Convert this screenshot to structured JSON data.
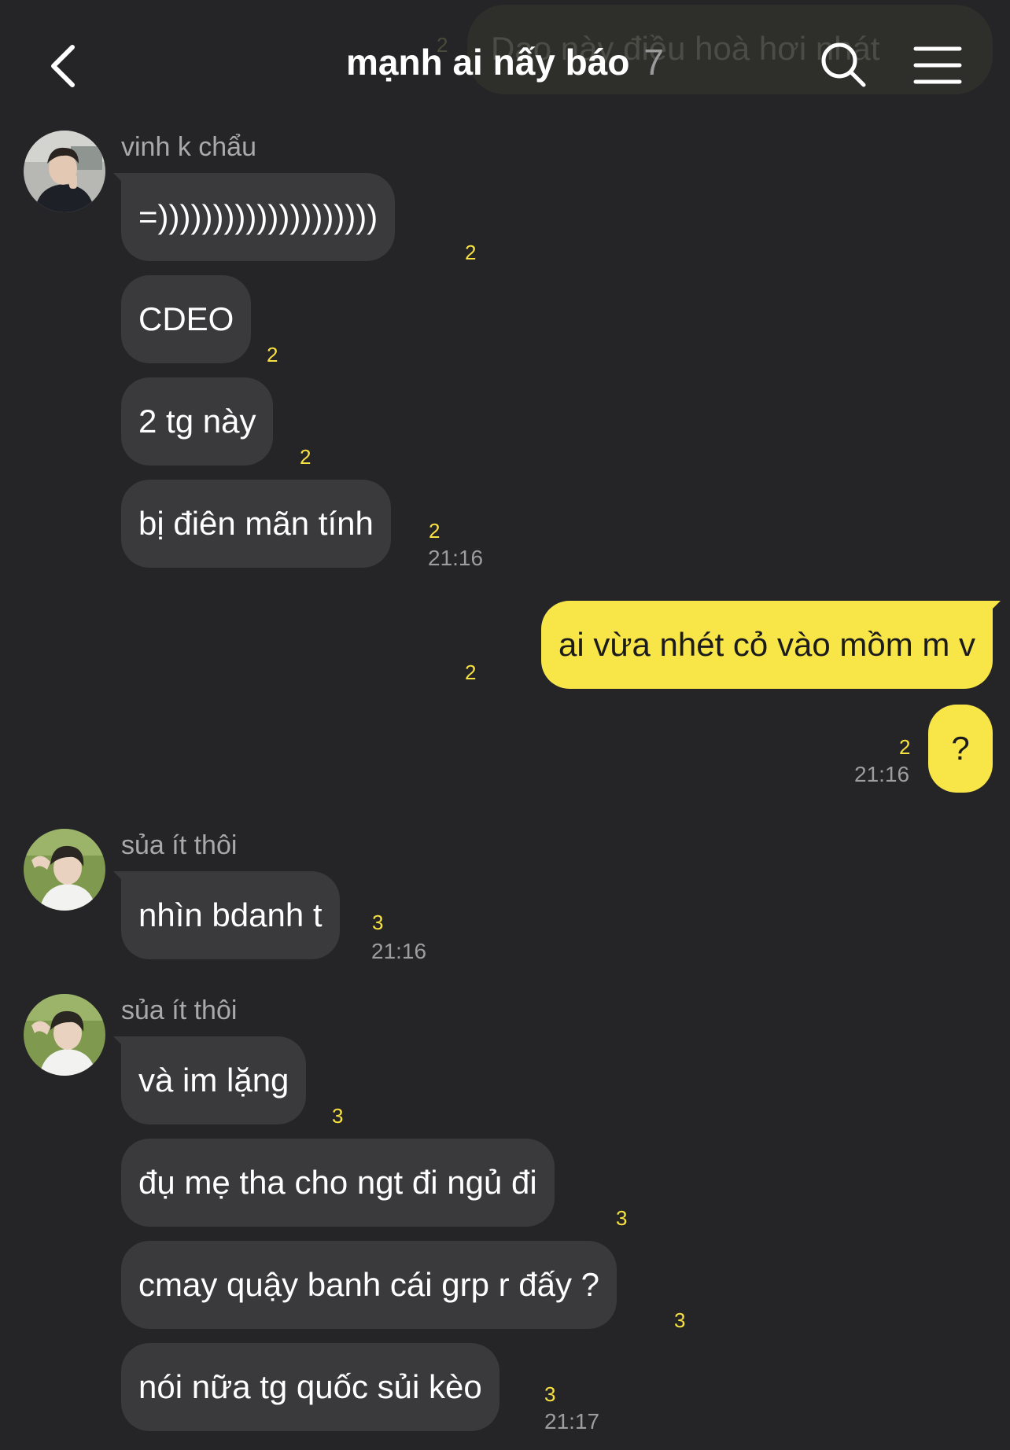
{
  "header": {
    "title": "mạnh ai nấy báo",
    "member_count": "7",
    "back_icon": "chevron-left-icon",
    "search_icon": "search-icon",
    "menu_icon": "hamburger-menu-icon",
    "pinned_preview": {
      "text": "Dạo này điều hoà hơi nhát",
      "count": "2"
    }
  },
  "messages": {
    "g1": {
      "sender": "vinh k chẩu",
      "m1": {
        "text": "=))))))))))))))))))))",
        "unread": "2"
      },
      "m2": {
        "text": "CDEO",
        "unread": "2"
      },
      "m3": {
        "text": "2 tg này",
        "unread": "2"
      },
      "m4": {
        "text": "bị điên mãn tính",
        "unread": "2",
        "time": "21:16"
      }
    },
    "mine": {
      "m1": {
        "text": "ai vừa nhét cỏ vào mồm m v",
        "unread": "2"
      },
      "m2": {
        "text": "?",
        "unread": "2",
        "time": "21:16"
      }
    },
    "g2": {
      "sender": "sủa ít thôi",
      "m1": {
        "text": "nhìn bdanh t",
        "unread": "3",
        "time": "21:16"
      }
    },
    "g3": {
      "sender": "sủa ít thôi",
      "m1": {
        "text": "và im lặng",
        "unread": "3"
      },
      "m2": {
        "text": "đụ mẹ tha cho ngt đi ngủ đi",
        "unread": "3"
      },
      "m3": {
        "text": "cmay quậy banh cái grp r đấy ?",
        "unread": "3"
      },
      "m4": {
        "text": "nói nữa tg quốc sủi kèo",
        "unread": "3",
        "time": "21:17"
      }
    }
  },
  "colors": {
    "background": "#252528",
    "incoming_bubble": "#3a3a3d",
    "outgoing_bubble": "#f8e648",
    "unread_count": "#f7e23f"
  }
}
